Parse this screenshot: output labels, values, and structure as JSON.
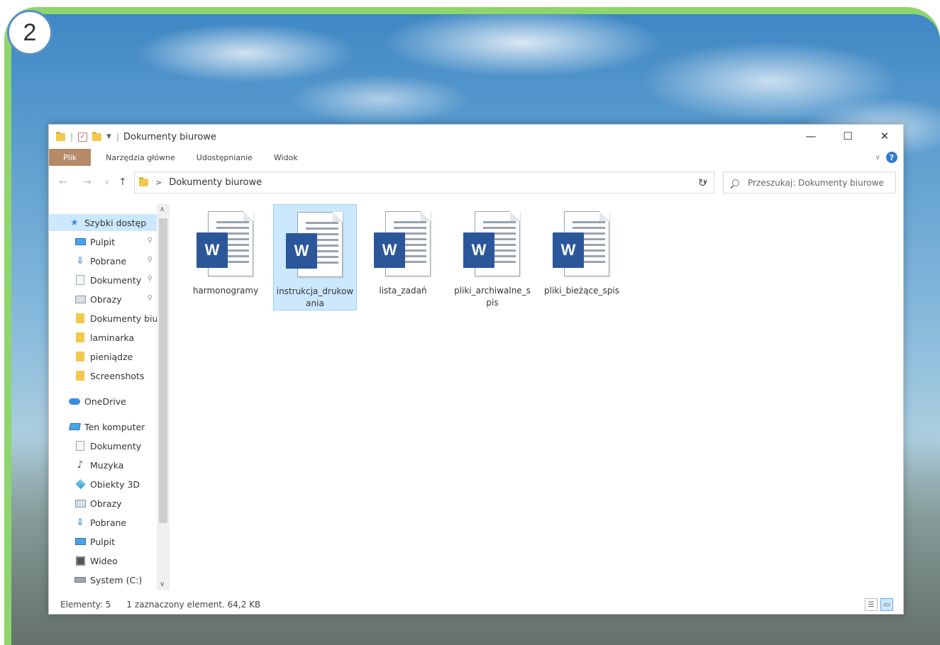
{
  "step": {
    "number": "2"
  },
  "window": {
    "title": "Dokumenty biurowe",
    "controls": {
      "minimize": "—",
      "maximize": "☐",
      "close": "✕"
    }
  },
  "ribbon": {
    "tabs": [
      "Plik",
      "Narzędzia główne",
      "Udostępnianie",
      "Widok"
    ],
    "help": "?"
  },
  "address": {
    "path": "Dokumenty biurowe",
    "search_placeholder": "Przeszukaj: Dokumenty biurowe"
  },
  "nav": {
    "items": [
      {
        "label": "Szybki dostęp",
        "icon": "star-icon",
        "pinned": false,
        "selected": true,
        "indent": 1
      },
      {
        "label": "Pulpit",
        "icon": "desktop-icon",
        "pinned": true,
        "indent": 2
      },
      {
        "label": "Pobrane",
        "icon": "download-icon",
        "pinned": true,
        "indent": 2
      },
      {
        "label": "Dokumenty",
        "icon": "documents-icon",
        "pinned": true,
        "indent": 2
      },
      {
        "label": "Obrazy",
        "icon": "pictures-icon",
        "pinned": true,
        "indent": 2
      },
      {
        "label": "Dokumenty biurowe",
        "icon": "folder-icon",
        "pinned": false,
        "indent": 2
      },
      {
        "label": "laminarka",
        "icon": "folder-icon",
        "pinned": false,
        "indent": 2
      },
      {
        "label": "pieniądze",
        "icon": "folder-icon",
        "pinned": false,
        "indent": 2
      },
      {
        "label": "Screenshots",
        "icon": "folder-icon",
        "pinned": false,
        "indent": 2
      },
      {
        "label": "OneDrive",
        "icon": "cloud-icon",
        "pinned": false,
        "indent": 1,
        "gap": true
      },
      {
        "label": "Ten komputer",
        "icon": "computer-icon",
        "pinned": false,
        "indent": 1,
        "gap": true
      },
      {
        "label": "Dokumenty",
        "icon": "documents-icon",
        "pinned": false,
        "indent": 2
      },
      {
        "label": "Muzyka",
        "icon": "music-icon",
        "pinned": false,
        "indent": 2
      },
      {
        "label": "Obiekty 3D",
        "icon": "3d-objects-icon",
        "pinned": false,
        "indent": 2
      },
      {
        "label": "Obrazy",
        "icon": "pictures-icon",
        "pinned": false,
        "indent": 2
      },
      {
        "label": "Pobrane",
        "icon": "download-icon",
        "pinned": false,
        "indent": 2
      },
      {
        "label": "Pulpit",
        "icon": "desktop-icon",
        "pinned": false,
        "indent": 2
      },
      {
        "label": "Wideo",
        "icon": "video-icon",
        "pinned": false,
        "indent": 2
      },
      {
        "label": "System (C:)",
        "icon": "drive-icon",
        "pinned": false,
        "indent": 2
      }
    ]
  },
  "files": [
    {
      "name": "harmonogramy",
      "type": "word-document-icon",
      "selected": false
    },
    {
      "name": "instrukcja_drukowania",
      "type": "word-document-icon",
      "selected": true
    },
    {
      "name": "lista_zadań",
      "type": "word-document-icon",
      "selected": false
    },
    {
      "name": "pliki_archiwalne_spis",
      "type": "word-document-icon",
      "selected": false
    },
    {
      "name": "pliki_bieżące_spis",
      "type": "word-document-icon",
      "selected": false
    }
  ],
  "word_badge": "W",
  "status": {
    "count": "Elementy: 5",
    "selection": "1 zaznaczony element. 64,2 KB"
  },
  "colors": {
    "frame": "#8fd56d",
    "file_tab": "#b68a67",
    "selection": "#cce8ff",
    "word_blue": "#2b579a"
  }
}
